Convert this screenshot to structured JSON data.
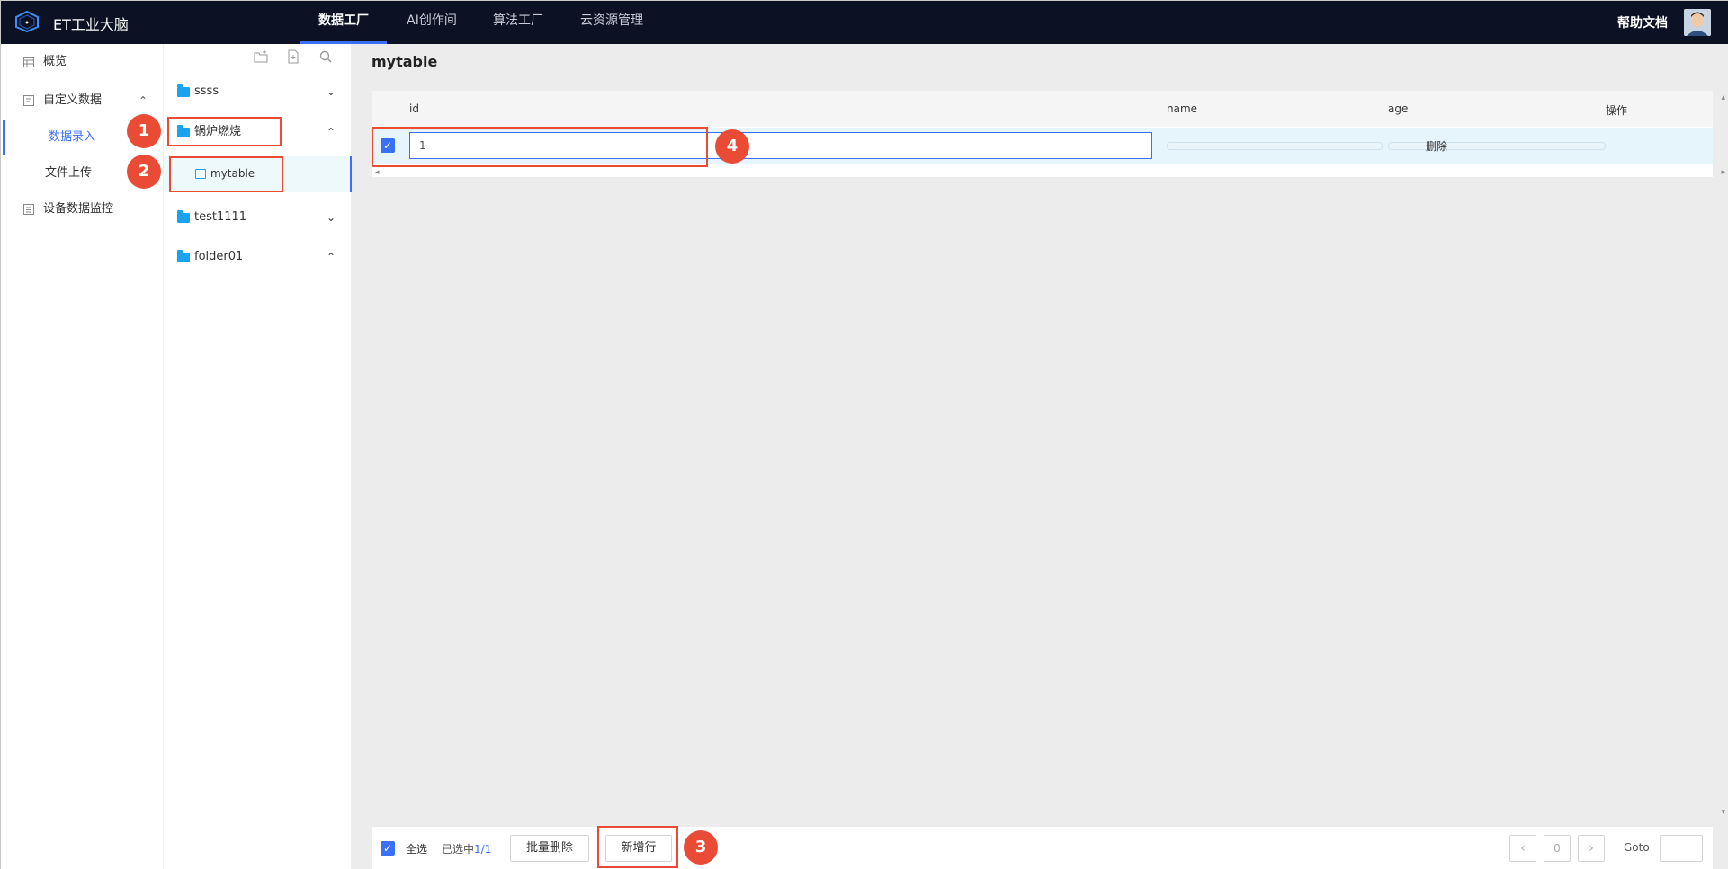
{
  "header": {
    "brand": "ET工业大脑",
    "nav": [
      "数据工厂",
      "AI创作间",
      "算法工厂",
      "云资源管理"
    ],
    "help": "帮助文档"
  },
  "sidebar": {
    "overview": "概览",
    "custom_data": "自定义数据",
    "data_entry": "数据录入",
    "file_upload": "文件上传",
    "device_monitor": "设备数据监控"
  },
  "tree": {
    "folders": [
      "ssss",
      "锅炉燃烧",
      "test1111",
      "folder01"
    ],
    "table": "mytable"
  },
  "main": {
    "title": "mytable",
    "columns": [
      "id",
      "name",
      "age",
      "操作"
    ],
    "row": {
      "id": "1",
      "name": "",
      "age": "",
      "action": "删除"
    }
  },
  "footer": {
    "select_all": "全选",
    "selected_prefix": "已选中",
    "selected_count": "1/1",
    "batch_delete": "批量删除",
    "add_row": "新增行",
    "page": "0",
    "goto": "Goto"
  },
  "annotations": [
    "1",
    "2",
    "3",
    "4"
  ],
  "colors": {
    "accent": "#3a6ff7",
    "annotation": "#e94b35",
    "topbar": "#0c1224",
    "folder": "#1aa4f0"
  }
}
